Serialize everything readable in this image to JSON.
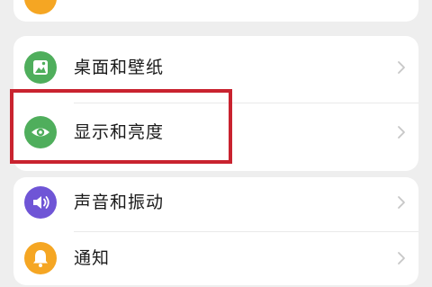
{
  "settings": {
    "top_item": {
      "icon": "partially-visible-orange-icon",
      "color": "#f5a623"
    },
    "items": [
      {
        "label": "桌面和壁纸",
        "icon": "wallpaper-image-icon",
        "color": "#4fae5c"
      },
      {
        "label": "显示和亮度",
        "icon": "eye-display-icon",
        "color": "#4fae5c"
      },
      {
        "label": "声音和振动",
        "icon": "speaker-volume-icon",
        "color": "#6f55d6"
      },
      {
        "label": "通知",
        "icon": "bell-notification-icon",
        "color": "#f5a623"
      }
    ],
    "chevron_icon": "chevron-right-icon"
  },
  "highlight": {
    "target": "显示和亮度",
    "color": "#c9232f"
  }
}
